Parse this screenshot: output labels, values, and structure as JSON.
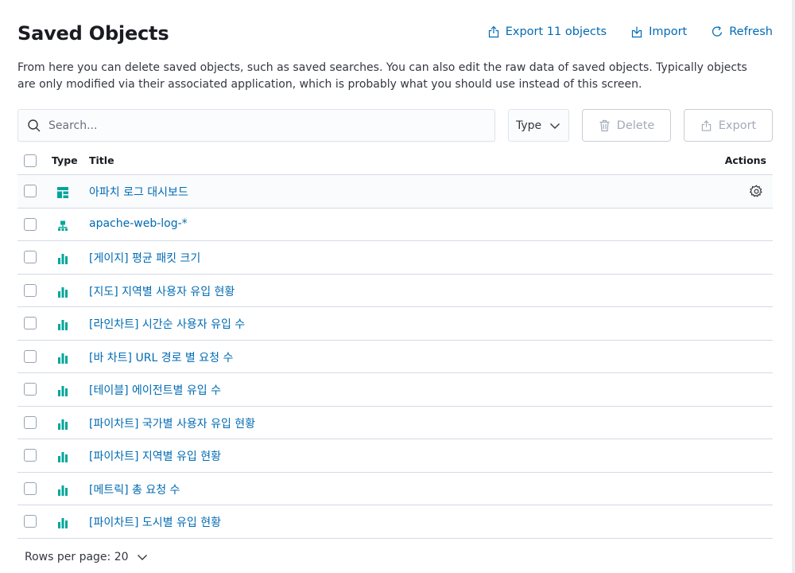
{
  "header": {
    "title": "Saved Objects",
    "export_all_label": "Export 11 objects",
    "import_label": "Import",
    "refresh_label": "Refresh"
  },
  "description": "From here you can delete saved objects, such as saved searches. You can also edit the raw data of saved objects. Typically objects are only modified via their associated application, which is probably what you should use instead of this screen.",
  "toolbar": {
    "search_placeholder": "Search...",
    "type_filter_label": "Type",
    "delete_label": "Delete",
    "export_label": "Export"
  },
  "table": {
    "columns": {
      "type": "Type",
      "title": "Title",
      "actions": "Actions"
    },
    "rows": [
      {
        "type_icon": "dashboard-icon",
        "title": "아파치 로그 대시보드"
      },
      {
        "type_icon": "index-pattern-icon",
        "title": "apache-web-log-*"
      },
      {
        "type_icon": "visualization-icon",
        "title": "[게이지] 평균 패킷 크기"
      },
      {
        "type_icon": "visualization-icon",
        "title": "[지도] 지역별 사용자 유입 현황"
      },
      {
        "type_icon": "visualization-icon",
        "title": "[라인차트] 시간순 사용자 유입 수"
      },
      {
        "type_icon": "visualization-icon",
        "title": "[바 차트] URL 경로 별 요청 수"
      },
      {
        "type_icon": "visualization-icon",
        "title": "[테이블] 에이전트별 유입 수"
      },
      {
        "type_icon": "visualization-icon",
        "title": "[파이차트] 국가별 사용자 유입 현황"
      },
      {
        "type_icon": "visualization-icon",
        "title": "[파이차트] 지역별 유입 현황"
      },
      {
        "type_icon": "visualization-icon",
        "title": "[메트릭] 총 요청 수"
      },
      {
        "type_icon": "visualization-icon",
        "title": "[파이차트] 도시별 유입 현황"
      }
    ]
  },
  "pagination": {
    "rows_per_page_label": "Rows per page: 20"
  },
  "colors": {
    "link": "#006bb4",
    "icon_teal": "#00a69b",
    "border": "#d3dae6",
    "disabled": "#a2abba"
  }
}
